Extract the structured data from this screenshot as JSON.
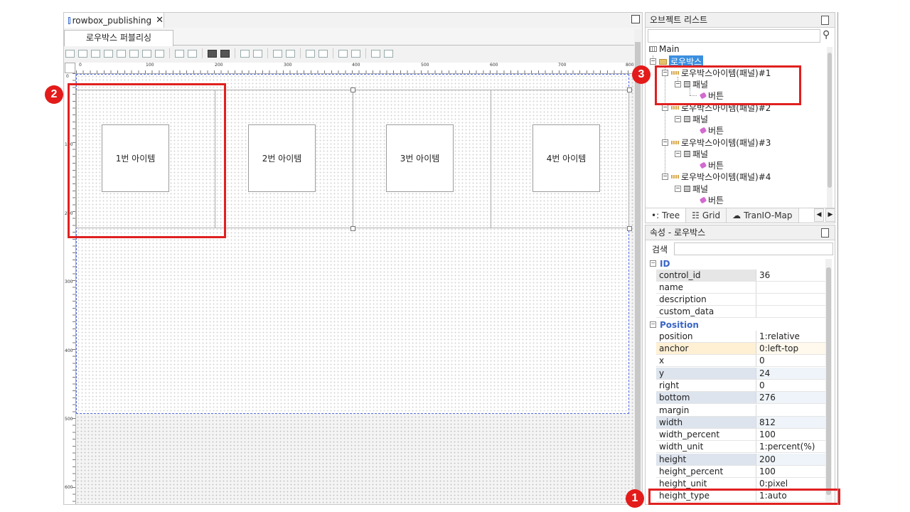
{
  "document_tab": {
    "title": "rowbox_publishing",
    "close": "✕"
  },
  "sub_tab": {
    "label": "로우박스 퍼블리싱"
  },
  "ruler": {
    "h_labels": [
      "0",
      "100",
      "200",
      "300",
      "400",
      "500",
      "600",
      "700",
      "800"
    ],
    "v_labels": [
      "0",
      "100",
      "200",
      "300",
      "400",
      "500",
      "600"
    ]
  },
  "canvas": {
    "items": [
      {
        "label": "1번 아이템"
      },
      {
        "label": "2번 아이템"
      },
      {
        "label": "3번 아이템"
      },
      {
        "label": "4번 아이템"
      }
    ]
  },
  "badges": {
    "one": "1",
    "two": "2",
    "three": "3"
  },
  "object_list": {
    "title": "오브젝트 리스트",
    "search_placeholder": "",
    "root": "Main",
    "selected": "로우박스",
    "rowbox_items": [
      {
        "label": "로우박스아이템(패널)#1",
        "panel": "패널",
        "button": "버튼"
      },
      {
        "label": "로우박스아이템(패널)#2",
        "panel": "패널",
        "button": "버튼"
      },
      {
        "label": "로우박스아이템(패널)#3",
        "panel": "패널",
        "button": "버튼"
      },
      {
        "label": "로우박스아이템(패널)#4",
        "panel": "패널",
        "button": "버튼"
      }
    ],
    "tabs": [
      "Tree",
      "Grid",
      "TranIO-Map"
    ]
  },
  "properties": {
    "title": "속성 - 로우박스",
    "search_label": "검색",
    "groups": [
      {
        "name": "ID",
        "rows": [
          {
            "key": "control_id",
            "value": "36"
          },
          {
            "key": "name",
            "value": ""
          },
          {
            "key": "description",
            "value": ""
          },
          {
            "key": "custom_data",
            "value": ""
          }
        ]
      },
      {
        "name": "Position",
        "rows": [
          {
            "key": "position",
            "value": "1:relative"
          },
          {
            "key": "anchor",
            "value": "0:left-top"
          },
          {
            "key": "x",
            "value": "0"
          },
          {
            "key": "y",
            "value": "24"
          },
          {
            "key": "right",
            "value": "0"
          },
          {
            "key": "bottom",
            "value": "276"
          },
          {
            "key": "margin",
            "value": ""
          },
          {
            "key": "width",
            "value": "812"
          },
          {
            "key": "width_percent",
            "value": "100"
          },
          {
            "key": "width_unit",
            "value": "1:percent(%)"
          },
          {
            "key": "height",
            "value": "200"
          },
          {
            "key": "height_percent",
            "value": "100"
          },
          {
            "key": "height_unit",
            "value": "0:pixel"
          },
          {
            "key": "height_type",
            "value": "1:auto"
          }
        ]
      }
    ]
  },
  "colors": {
    "annotation_red": "#e02020",
    "selection_blue": "#3b8fe0",
    "group_header": "#3a66c4"
  }
}
